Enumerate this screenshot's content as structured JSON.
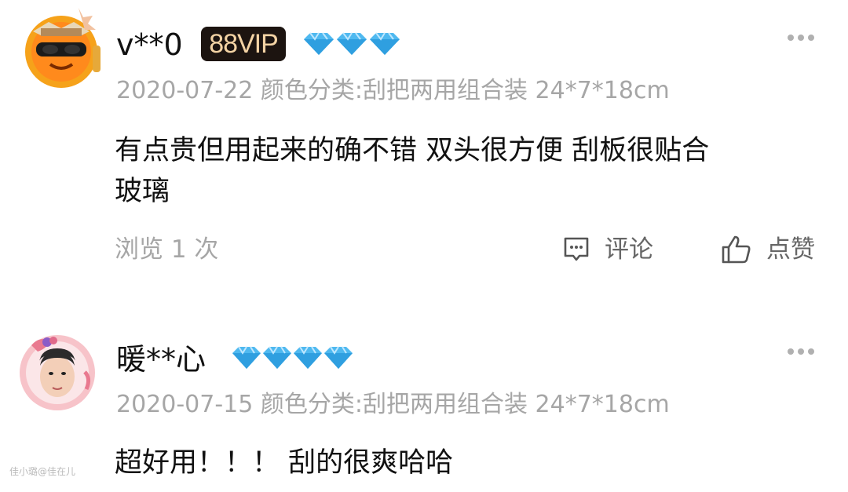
{
  "colors": {
    "meta_gray": "#a6a6a6",
    "action_gray": "#666666",
    "diamond_blue": "#4fb9f0",
    "vip_bg": "#1c1410",
    "vip_text": "#f3d3a4"
  },
  "reviews": [
    {
      "username": "v**0",
      "vip_badge": "88VIP",
      "diamond_count": 3,
      "date": "2020-07-22",
      "variant": "颜色分类:刮把两用组合装 24*7*18cm",
      "content_line1": "有点贵但用起来的确不错 双头很方便  刮板很贴合",
      "content_line2": "玻璃",
      "views": "浏览 1 次",
      "comment_label": "评论",
      "like_label": "点赞",
      "avatar_icon": "orange-mascot-avatar-icon",
      "more_icon": "more-dots-icon"
    },
    {
      "username": "暖**心",
      "diamond_count": 4,
      "date": "2020-07-15",
      "variant": "颜色分类:刮把两用组合装 24*7*18cm",
      "content_line1": "超好用！！！ 刮的很爽哈哈",
      "avatar_icon": "portrait-avatar-icon",
      "more_icon": "more-dots-icon"
    }
  ],
  "watermark": "佳小璐@佳在儿"
}
